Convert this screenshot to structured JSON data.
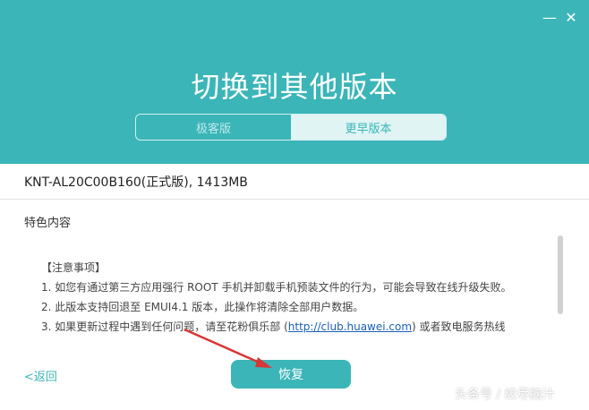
{
  "window": {
    "minimize_icon": "minimize-icon",
    "close_icon": "close-icon"
  },
  "header": {
    "title": "切换到其他版本",
    "tabs": [
      {
        "label": "极客版",
        "active": false
      },
      {
        "label": "更早版本",
        "active": true
      }
    ]
  },
  "version": {
    "text": "KNT-AL20C00B160(正式版), 1413MB"
  },
  "content": {
    "section_title": "特色内容",
    "notes_heading": "【注意事项】",
    "notes": [
      "1. 如您有通过第三方应用强行 ROOT 手机并卸载手机预装文件的行为，可能会导致在线升级失败。",
      "2. 此版本支持回退至 EMUI4.1 版本，此操作将清除全部用户数据。"
    ],
    "note3_prefix": "3. 如果更新过程中遇到任何问题，请至花粉俱乐部 (",
    "note3_link": "http://club.huawei.com",
    "note3_suffix": ") 或者致电服务热线"
  },
  "footer": {
    "back_label": "<返回",
    "restore_label": "恢复"
  },
  "watermark": "头条号 / 绞尽脑汁",
  "colors": {
    "accent": "#3bb5b8",
    "annotation_arrow": "#d93636"
  }
}
